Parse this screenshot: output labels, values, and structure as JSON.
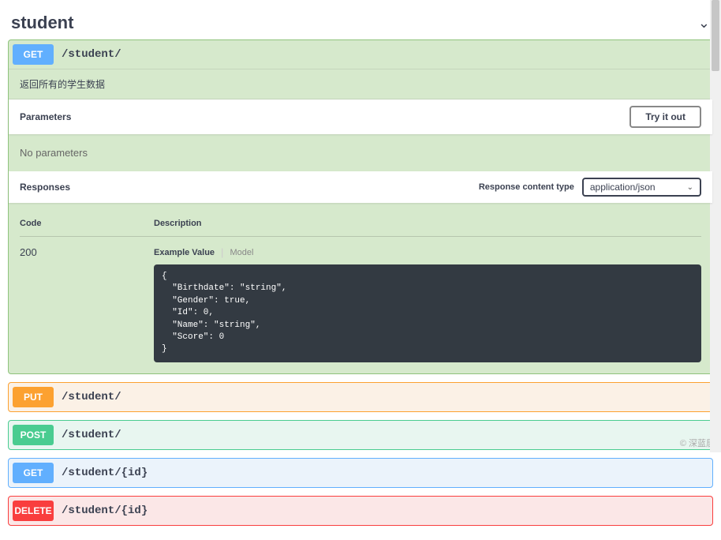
{
  "section": {
    "title": "student"
  },
  "endpoints": {
    "get1": {
      "method": "GET",
      "path": "/student/",
      "description": "返回所有的学生数据"
    },
    "put": {
      "method": "PUT",
      "path": "/student/"
    },
    "post": {
      "method": "POST",
      "path": "/student/"
    },
    "get2": {
      "method": "GET",
      "path": "/student/{id}"
    },
    "delete": {
      "method": "DELETE",
      "path": "/student/{id}"
    }
  },
  "parameters": {
    "label": "Parameters",
    "none": "No parameters",
    "try_label": "Try it out"
  },
  "responses": {
    "label": "Responses",
    "content_type_label": "Response content type",
    "content_type_value": "application/json",
    "code_header": "Code",
    "desc_header": "Description",
    "code": "200",
    "tab_example": "Example Value",
    "tab_model": "Model",
    "example": "{\n  \"Birthdate\": \"string\",\n  \"Gender\": true,\n  \"Id\": 0,\n  \"Name\": \"string\",\n  \"Score\": 0\n}"
  },
  "watermark": "© 深蓝居"
}
